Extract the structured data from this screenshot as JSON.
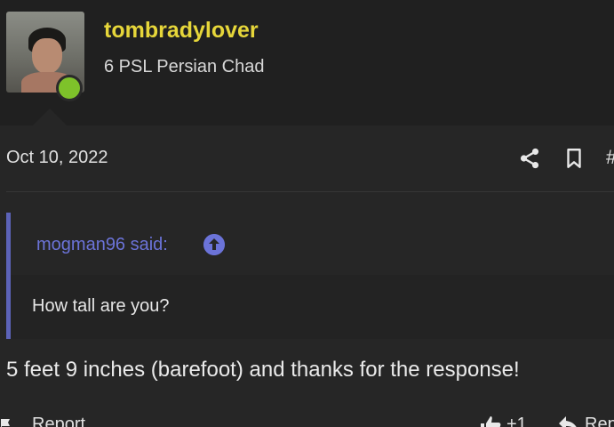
{
  "user": {
    "name": "tombradylover",
    "title": "6 PSL Persian Chad",
    "online": true,
    "colors": {
      "username": "#e6d63a",
      "online": "#7ec22a"
    }
  },
  "post": {
    "date": "Oct 10, 2022",
    "hash": "#",
    "quote": {
      "author_label": "mogman96 said:",
      "text": "How tall are you?",
      "accent": "#5c63b8"
    },
    "message": "5 feet 9 inches (barefoot) and thanks for the response!",
    "footer": {
      "report_label": "Report",
      "like_count": "+1",
      "reply_label": "Reply"
    }
  },
  "icons": [
    "share-icon",
    "bookmark-icon",
    "up-arrow-icon",
    "flag-icon",
    "thumbs-up-icon",
    "reply-icon"
  ]
}
